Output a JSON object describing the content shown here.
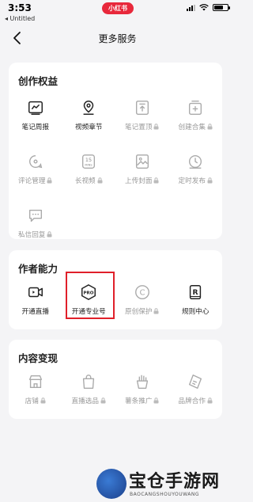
{
  "status": {
    "time": "3:53",
    "back_app": "◂ Untitled",
    "app_badge": "小红书"
  },
  "nav": {
    "title": "更多服务"
  },
  "sections": [
    {
      "title": "创作权益",
      "items": [
        {
          "label": "笔记周报",
          "icon": "report-chart-icon",
          "locked": false
        },
        {
          "label": "视频章节",
          "icon": "location-pin-icon",
          "locked": false
        },
        {
          "label": "笔记置顶",
          "icon": "pin-top-icon",
          "locked": true
        },
        {
          "label": "创建合集",
          "icon": "collection-add-icon",
          "locked": true
        },
        {
          "label": "评论管理",
          "icon": "comment-manage-icon",
          "locked": true
        },
        {
          "label": "长视频",
          "icon": "15-mins-icon",
          "locked": true
        },
        {
          "label": "上传封面",
          "icon": "image-upload-icon",
          "locked": true
        },
        {
          "label": "定时发布",
          "icon": "clock-icon",
          "locked": true
        },
        {
          "label": "私信回复",
          "icon": "message-icon",
          "locked": true
        }
      ]
    },
    {
      "title": "作者能力",
      "items": [
        {
          "label": "开通直播",
          "icon": "live-camera-icon",
          "locked": false
        },
        {
          "label": "开通专业号",
          "icon": "pro-badge-icon",
          "locked": false,
          "highlight": true
        },
        {
          "label": "原创保护",
          "icon": "copyright-icon",
          "locked": true
        },
        {
          "label": "规则中心",
          "icon": "rules-r-icon",
          "locked": false
        }
      ]
    },
    {
      "title": "内容变现",
      "items": [
        {
          "label": "店铺",
          "icon": "shop-icon",
          "locked": true
        },
        {
          "label": "直播选品",
          "icon": "shopping-bag-icon",
          "locked": true
        },
        {
          "label": "薯条推广",
          "icon": "fries-icon",
          "locked": true
        },
        {
          "label": "品牌合作",
          "icon": "brand-tag-icon",
          "locked": true
        }
      ]
    }
  ],
  "icon_text": {
    "mins_15": "15",
    "mins_label": "MINS",
    "pro": "PRO",
    "r": "R",
    "c": "C"
  },
  "watermark": {
    "title": "宝仓手游网",
    "subtitle": "BAOCANGSHOUYOUWANG"
  },
  "colors": {
    "accent_red": "#e8283b",
    "highlight_border": "#e0202a",
    "disabled_gray": "#999999"
  }
}
